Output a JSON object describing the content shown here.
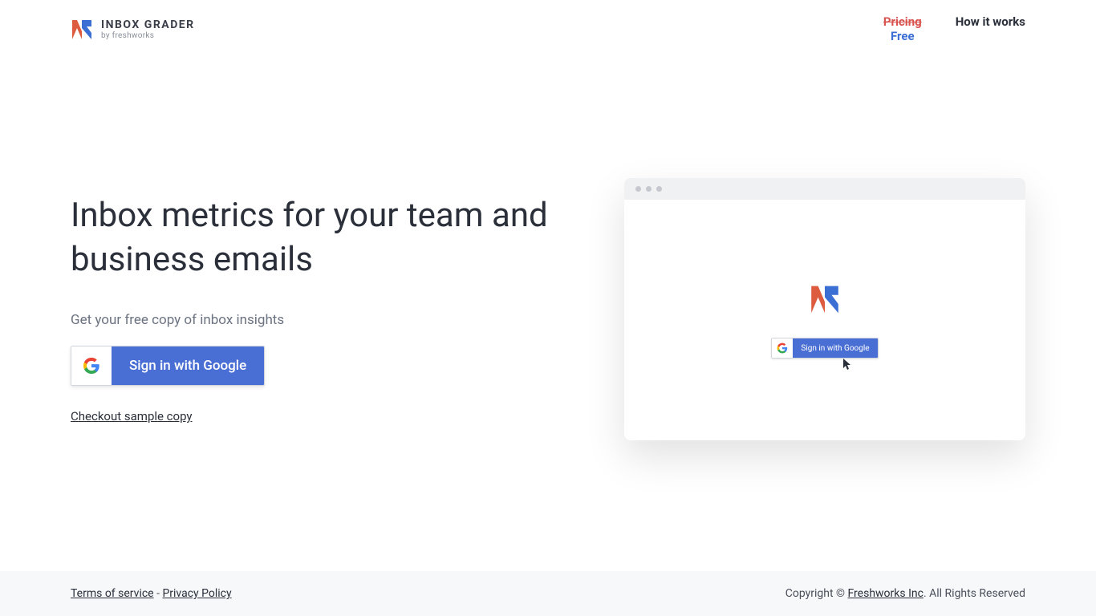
{
  "header": {
    "logo_title": "INBOX GRADER",
    "logo_subtitle": "by freshworks"
  },
  "nav": {
    "pricing_strike": "Pricing",
    "pricing_free": "Free",
    "how_it_works": "How it works"
  },
  "hero": {
    "headline": "Inbox metrics for your team and business emails",
    "subtext": "Get your free copy of inbox insights",
    "google_button": "Sign in with Google",
    "sample_link": "Checkout sample copy"
  },
  "mockup": {
    "signin_text": "Sign in with Google"
  },
  "footer": {
    "terms": "Terms of service",
    "separator": " - ",
    "privacy": "Privacy Policy",
    "copyright_prefix": "Copyright © ",
    "company": "Freshworks Inc",
    "copyright_suffix": ". All Rights Reserved"
  }
}
